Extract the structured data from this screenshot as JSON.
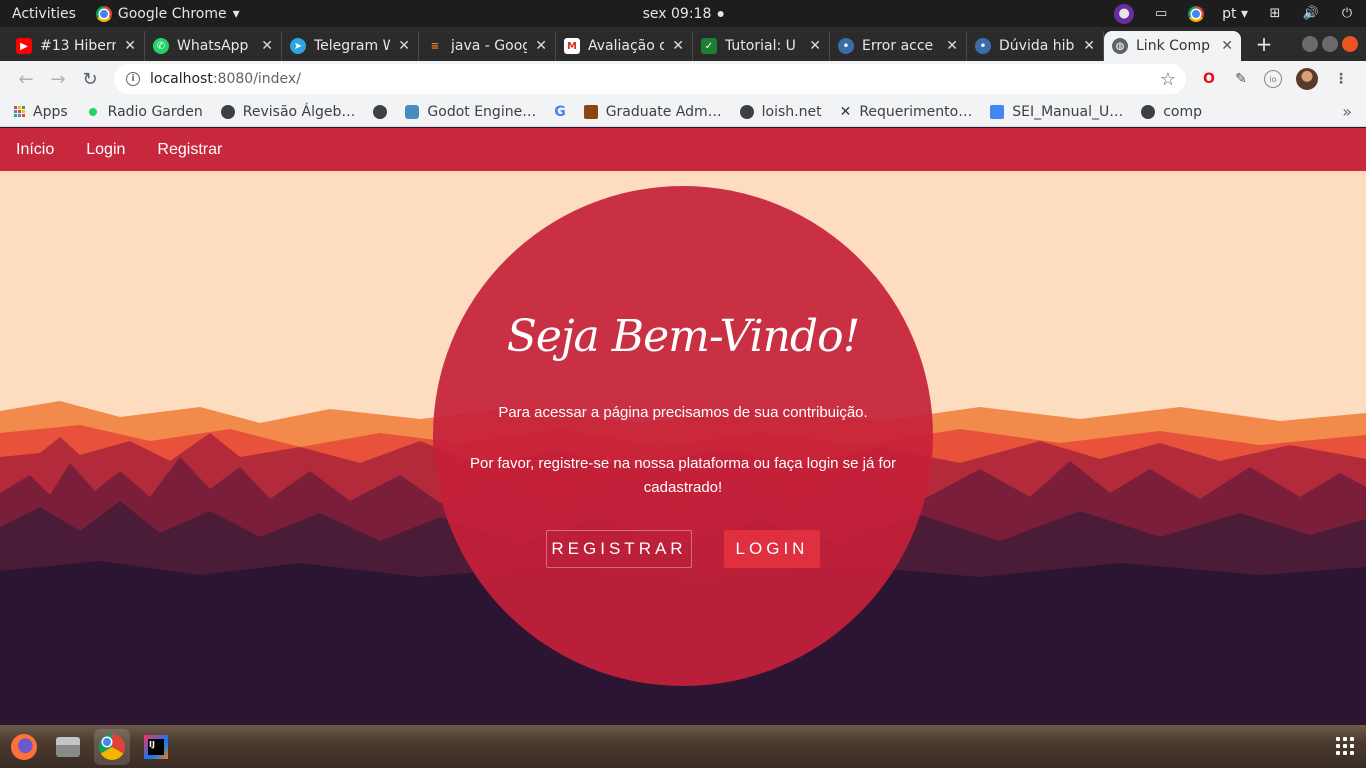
{
  "topbar": {
    "activities": "Activities",
    "app_name": "Google Chrome",
    "clock": "sex 09:18",
    "language": "pt"
  },
  "tabs": [
    {
      "title": "#13 Hibern",
      "favicon": "youtube-icon",
      "color": "#ff0000"
    },
    {
      "title": "WhatsApp",
      "favicon": "whatsapp-icon",
      "color": "#25d366"
    },
    {
      "title": "Telegram W",
      "favicon": "telegram-icon",
      "color": "#2ca5e0"
    },
    {
      "title": "java - Goog",
      "favicon": "stackoverflow-icon",
      "color": "#f48024"
    },
    {
      "title": "Avaliação d",
      "favicon": "gmail-icon",
      "color": "#d93025"
    },
    {
      "title": "Tutorial: U",
      "favicon": "check-icon",
      "color": "#1e7e34"
    },
    {
      "title": "Error acce",
      "favicon": "stack-icon",
      "color": "#3b6ea8"
    },
    {
      "title": "Dúvida hib",
      "favicon": "stack-icon",
      "color": "#3b6ea8"
    },
    {
      "title": "Link Comp",
      "favicon": "globe-icon",
      "color": "#5f6368",
      "active": true
    }
  ],
  "address": {
    "host": "localhost",
    "path": ":8080/index/"
  },
  "bookmarks": [
    {
      "label": "Apps",
      "icon": "apps-grid-icon",
      "color": "#ea4335"
    },
    {
      "label": "Radio Garden",
      "icon": "radio-garden-icon",
      "color": "#1ed760"
    },
    {
      "label": "Revisão Álgeb…",
      "icon": "globe-icon",
      "color": "#5f6368"
    },
    {
      "label": "",
      "icon": "globe-icon",
      "color": "#5f6368"
    },
    {
      "label": "Godot Engine…",
      "icon": "godot-icon",
      "color": "#478cbf"
    },
    {
      "label": "",
      "icon": "google-icon",
      "color": "#4285f4"
    },
    {
      "label": "Graduate Adm…",
      "icon": "university-icon",
      "color": "#8b4513"
    },
    {
      "label": "loish.net",
      "icon": "globe-icon",
      "color": "#5f6368"
    },
    {
      "label": "Requerimento…",
      "icon": "tools-icon",
      "color": "#2b3a55"
    },
    {
      "label": "SEI_Manual_U…",
      "icon": "docs-icon",
      "color": "#4285f4"
    },
    {
      "label": "comp",
      "icon": "globe-icon",
      "color": "#5f6368"
    }
  ],
  "site": {
    "nav": [
      "Início",
      "Login",
      "Registrar"
    ],
    "welcome": "Seja Bem-Vindo!",
    "message1": "Para acessar a página precisamos de sua contribuição.",
    "message2": "Por favor, registre-se na nossa plataforma ou faça login se já for cadastrado!",
    "register_button": "REGISTRAR",
    "login_button": "LOGIN",
    "colors": {
      "navbar": "#c8283e",
      "circle": "#c5213a",
      "sky": "#fddcc0",
      "login_button": "#e0303f"
    }
  },
  "dock": [
    "firefox-icon",
    "files-icon",
    "chrome-icon",
    "intellij-icon"
  ]
}
